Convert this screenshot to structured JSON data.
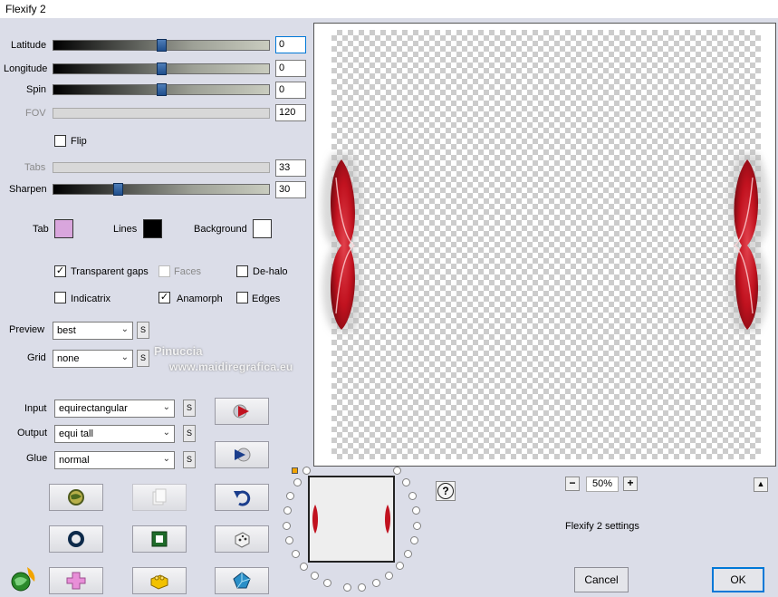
{
  "window": {
    "title": "Flexify 2"
  },
  "sliders": {
    "latitude": {
      "label": "Latitude",
      "value": "0",
      "fraction": 0.5
    },
    "longitude": {
      "label": "Longitude",
      "value": "0",
      "fraction": 0.5
    },
    "spin": {
      "label": "Spin",
      "value": "0",
      "fraction": 0.5
    },
    "fov": {
      "label": "FOV",
      "value": "120"
    },
    "tabs": {
      "label": "Tabs",
      "value": "33"
    },
    "sharpen": {
      "label": "Sharpen",
      "value": "30",
      "fraction": 0.3
    }
  },
  "flip": {
    "label": "Flip",
    "checked": false
  },
  "colors": {
    "tab": {
      "label": "Tab",
      "hex": "#d9a6dd"
    },
    "lines": {
      "label": "Lines",
      "hex": "#000000"
    },
    "background": {
      "label": "Background",
      "hex": "#ffffff"
    }
  },
  "options": {
    "transparent_gaps": {
      "label": "Transparent gaps",
      "checked": true
    },
    "faces": {
      "label": "Faces",
      "checked": false
    },
    "de_halo": {
      "label": "De-halo",
      "checked": false
    },
    "indicatrix": {
      "label": "Indicatrix",
      "checked": false
    },
    "anamorph": {
      "label": "Anamorph",
      "checked": true
    },
    "edges": {
      "label": "Edges",
      "checked": false
    }
  },
  "preview_select": {
    "label": "Preview",
    "value": "best"
  },
  "grid_select": {
    "label": "Grid",
    "value": "none"
  },
  "input_select": {
    "label": "Input",
    "value": "equirectangular"
  },
  "output_select": {
    "label": "Output",
    "value": "equi tall"
  },
  "glue_select": {
    "label": "Glue",
    "value": "normal"
  },
  "s_label": "S",
  "watermark": {
    "line1": "Pinuccia",
    "line2": "www.maidiregrafica.eu"
  },
  "zoom": {
    "minus": "−",
    "value": "50%",
    "plus": "+"
  },
  "help": "?",
  "collapse": "▲",
  "settings_label": "Flexify 2 settings",
  "buttons": {
    "cancel": "Cancel",
    "ok": "OK"
  },
  "accent": {
    "ok_border": "#0078d7",
    "ribbon": "#c1121f"
  }
}
